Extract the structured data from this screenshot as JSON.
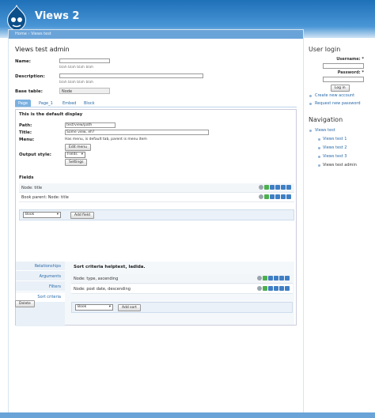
{
  "site": {
    "name": "Views 2"
  },
  "breadcrumb": [
    "Home",
    "Views test"
  ],
  "page_title": "Views test admin",
  "form": {
    "name_label": "Name:",
    "name_desc": "blah blah blah blah",
    "description_label": "Description:",
    "description_desc": "blah blah blah blah",
    "base_table_label": "Base table:",
    "base_table_value": "Node"
  },
  "tabs": [
    "Page",
    "Page_1",
    "Embed",
    "Block"
  ],
  "display": {
    "heading": "This is the default display",
    "path_label": "Path:",
    "path_value": "test/view/path",
    "title_label": "Title:",
    "title_value": "Some view, eh?",
    "menu_label": "Menu:",
    "menu_value": "Has menu, is default tab, parent is menu item",
    "edit_menu": "Edit menu",
    "output_style_label": "Output style:",
    "output_style_value": "Fields",
    "settings_button": "Settings"
  },
  "fields": {
    "heading": "Fields",
    "rows": [
      "Node: title",
      "Book parent: Node: title"
    ],
    "select_value": "Book",
    "add_button": "Add field"
  },
  "vertical_tabs": [
    "Relationships",
    "Arguments",
    "Filters",
    "Sort criteria"
  ],
  "sort": {
    "help": "Sort criteria helptext, ladida.",
    "rows": [
      "Node: type, ascending",
      "Node: post date, descending"
    ],
    "select_value": "Book",
    "add_button": "Add sort"
  },
  "delete_button": "Delete",
  "sidebar": {
    "login_title": "User login",
    "username_label": "Username: *",
    "password_label": "Password: *",
    "login_button": "Log in",
    "links": [
      "Create new account",
      "Request new password"
    ],
    "nav_title": "Navigation",
    "nav_items": [
      "Views test",
      "Views test 1",
      "Views test 2",
      "Views test 3",
      "Views test admin"
    ]
  }
}
